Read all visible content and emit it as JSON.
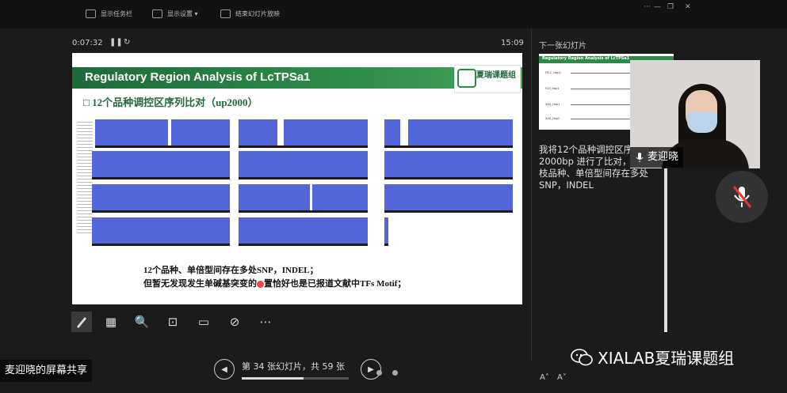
{
  "toolbar": {
    "show_taskbar": "显示任务栏",
    "display_settings": "显示设置 ▾",
    "end_show": "结束幻灯片放映"
  },
  "presenter": {
    "elapsed": "0:07:32",
    "clock": "15:09",
    "next_slide_label": "下一张幻灯片"
  },
  "slide": {
    "title": "Regulatory Region Analysis of LcTPSa1",
    "logo_text": "夏瑞课题组",
    "subtitle": "□ 12个品种调控区序列比对（up2000）",
    "bullet1": "12个品种、单倍型间存在多处SNP，INDEL；",
    "bullet2_pre": "但暂无发现发生单碱基突变的",
    "bullet2_post": "置恰好也是已报道文献中TFs Motif；"
  },
  "thumbnail": {
    "title": "Regulatory Region Analysis of LcTPSa1",
    "rows": [
      "FELC_Hap1",
      "FLH_Hap1",
      "XXX_Hap1",
      "XXX_Hap2"
    ]
  },
  "notes": "我将12个品种调控区序列 2000bp 进行了比对，12个荔枝品种、单倍型间存在多处SNP，INDEL",
  "camera": {
    "name": "麦迎晓"
  },
  "navigation": {
    "slide_counter": "第 34 张幻灯片，共 59 张",
    "progress": 0.576
  },
  "screen_share": "麦迎晓的屏幕共享",
  "watermark": "XIALAB夏瑞课题组",
  "colors": {
    "header_green": "#2e8b48",
    "alignment_blue": "#5266d8"
  }
}
